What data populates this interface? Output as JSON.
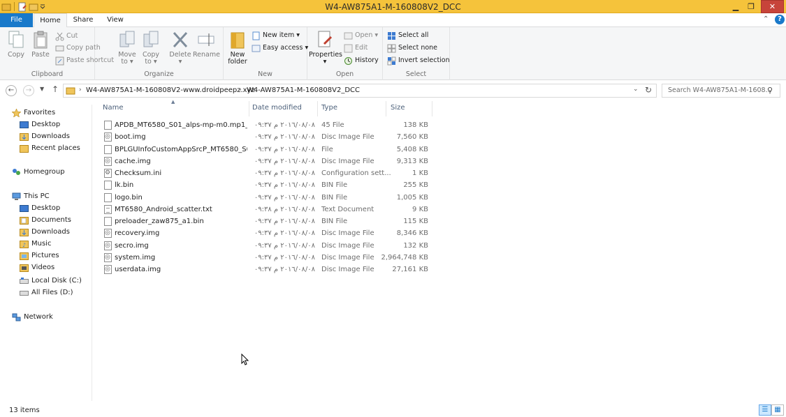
{
  "window": {
    "title": "W4-AW875A1-M-160808V2_DCC",
    "minimize_icon": "minimize-icon",
    "maximize_icon": "restore-icon",
    "close_icon": "close-icon"
  },
  "ribbon_tabs": {
    "file": "File",
    "home": "Home",
    "share": "Share",
    "view": "View"
  },
  "ribbon": {
    "clipboard": {
      "label": "Clipboard",
      "copy": "Copy",
      "paste": "Paste",
      "cut": "Cut",
      "copy_path": "Copy path",
      "paste_shortcut": "Paste shortcut"
    },
    "organize": {
      "label": "Organize",
      "move_to_1": "Move",
      "move_to_2": "to",
      "copy_to_1": "Copy",
      "copy_to_2": "to",
      "delete": "Delete",
      "rename": "Rename"
    },
    "new": {
      "label": "New",
      "new_folder_1": "New",
      "new_folder_2": "folder",
      "new_item": "New item",
      "easy_access": "Easy access"
    },
    "open": {
      "label": "Open",
      "properties": "Properties",
      "open": "Open",
      "edit": "Edit",
      "history": "History"
    },
    "select": {
      "label": "Select",
      "select_all": "Select all",
      "select_none": "Select none",
      "invert_selection": "Invert selection"
    }
  },
  "address": {
    "crumb1": "W4-AW875A1-M-160808V2-www.droidpeepz.xyz",
    "crumb2": "W4-AW875A1-M-160808V2_DCC",
    "search_placeholder": "Search W4-AW875A1-M-1608..."
  },
  "nav": {
    "favorites": "Favorites",
    "desktop": "Desktop",
    "downloads": "Downloads",
    "recent_places": "Recent places",
    "homegroup": "Homegroup",
    "this_pc": "This PC",
    "pc_desktop": "Desktop",
    "documents": "Documents",
    "pc_downloads": "Downloads",
    "music": "Music",
    "pictures": "Pictures",
    "videos": "Videos",
    "local_disk": "Local Disk (C:)",
    "all_files": "All Files (D:)",
    "network": "Network"
  },
  "columns": {
    "name": "Name",
    "date": "Date modified",
    "type": "Type",
    "size": "Size"
  },
  "files": [
    {
      "name": "APDB_MT6580_S01_alps-mp-m0.mp1_W...",
      "date": "٢٠١٦/٠٨/٠٨ م ٠٩:٣٧",
      "type": "45 File",
      "size": "138 KB",
      "icon": "file"
    },
    {
      "name": "boot.img",
      "date": "٢٠١٦/٠٨/٠٨ م ٠٩:٣٧",
      "type": "Disc Image File",
      "size": "7,560 KB",
      "icon": "img"
    },
    {
      "name": "BPLGUInfoCustomAppSrcP_MT6580_S00...",
      "date": "٢٠١٦/٠٨/٠٨ م ٠٩:٣٧",
      "type": "File",
      "size": "5,408 KB",
      "icon": "file"
    },
    {
      "name": "cache.img",
      "date": "٢٠١٦/٠٨/٠٨ م ٠٩:٣٧",
      "type": "Disc Image File",
      "size": "9,313 KB",
      "icon": "img"
    },
    {
      "name": "Checksum.ini",
      "date": "٢٠١٦/٠٨/٠٨ م ٠٩:٣٧",
      "type": "Configuration sett...",
      "size": "1 KB",
      "icon": "ini"
    },
    {
      "name": "lk.bin",
      "date": "٢٠١٦/٠٨/٠٨ م ٠٩:٣٧",
      "type": "BIN File",
      "size": "255 KB",
      "icon": "file"
    },
    {
      "name": "logo.bin",
      "date": "٢٠١٦/٠٨/٠٨ م ٠٩:٣٧",
      "type": "BIN File",
      "size": "1,005 KB",
      "icon": "file"
    },
    {
      "name": "MT6580_Android_scatter.txt",
      "date": "٢٠١٦/٠٨/٠٨ م ٠٩:٣٨",
      "type": "Text Document",
      "size": "9 KB",
      "icon": "txt"
    },
    {
      "name": "preloader_zaw875_a1.bin",
      "date": "٢٠١٦/٠٨/٠٨ م ٠٩:٣٧",
      "type": "BIN File",
      "size": "115 KB",
      "icon": "file"
    },
    {
      "name": "recovery.img",
      "date": "٢٠١٦/٠٨/٠٨ م ٠٩:٣٧",
      "type": "Disc Image File",
      "size": "8,346 KB",
      "icon": "img"
    },
    {
      "name": "secro.img",
      "date": "٢٠١٦/٠٨/٠٨ م ٠٩:٣٧",
      "type": "Disc Image File",
      "size": "132 KB",
      "icon": "img"
    },
    {
      "name": "system.img",
      "date": "٢٠١٦/٠٨/٠٨ م ٠٩:٣٧",
      "type": "Disc Image File",
      "size": "2,964,748 KB",
      "icon": "img"
    },
    {
      "name": "userdata.img",
      "date": "٢٠١٦/٠٨/٠٨ م ٠٩:٣٧",
      "type": "Disc Image File",
      "size": "27,161 KB",
      "icon": "img"
    }
  ],
  "status": {
    "count": "13 items"
  },
  "colors": {
    "titlebar": "#f5c33b",
    "file_tab": "#1979ca",
    "close": "#c7443a",
    "selection": "#cce8ff"
  }
}
